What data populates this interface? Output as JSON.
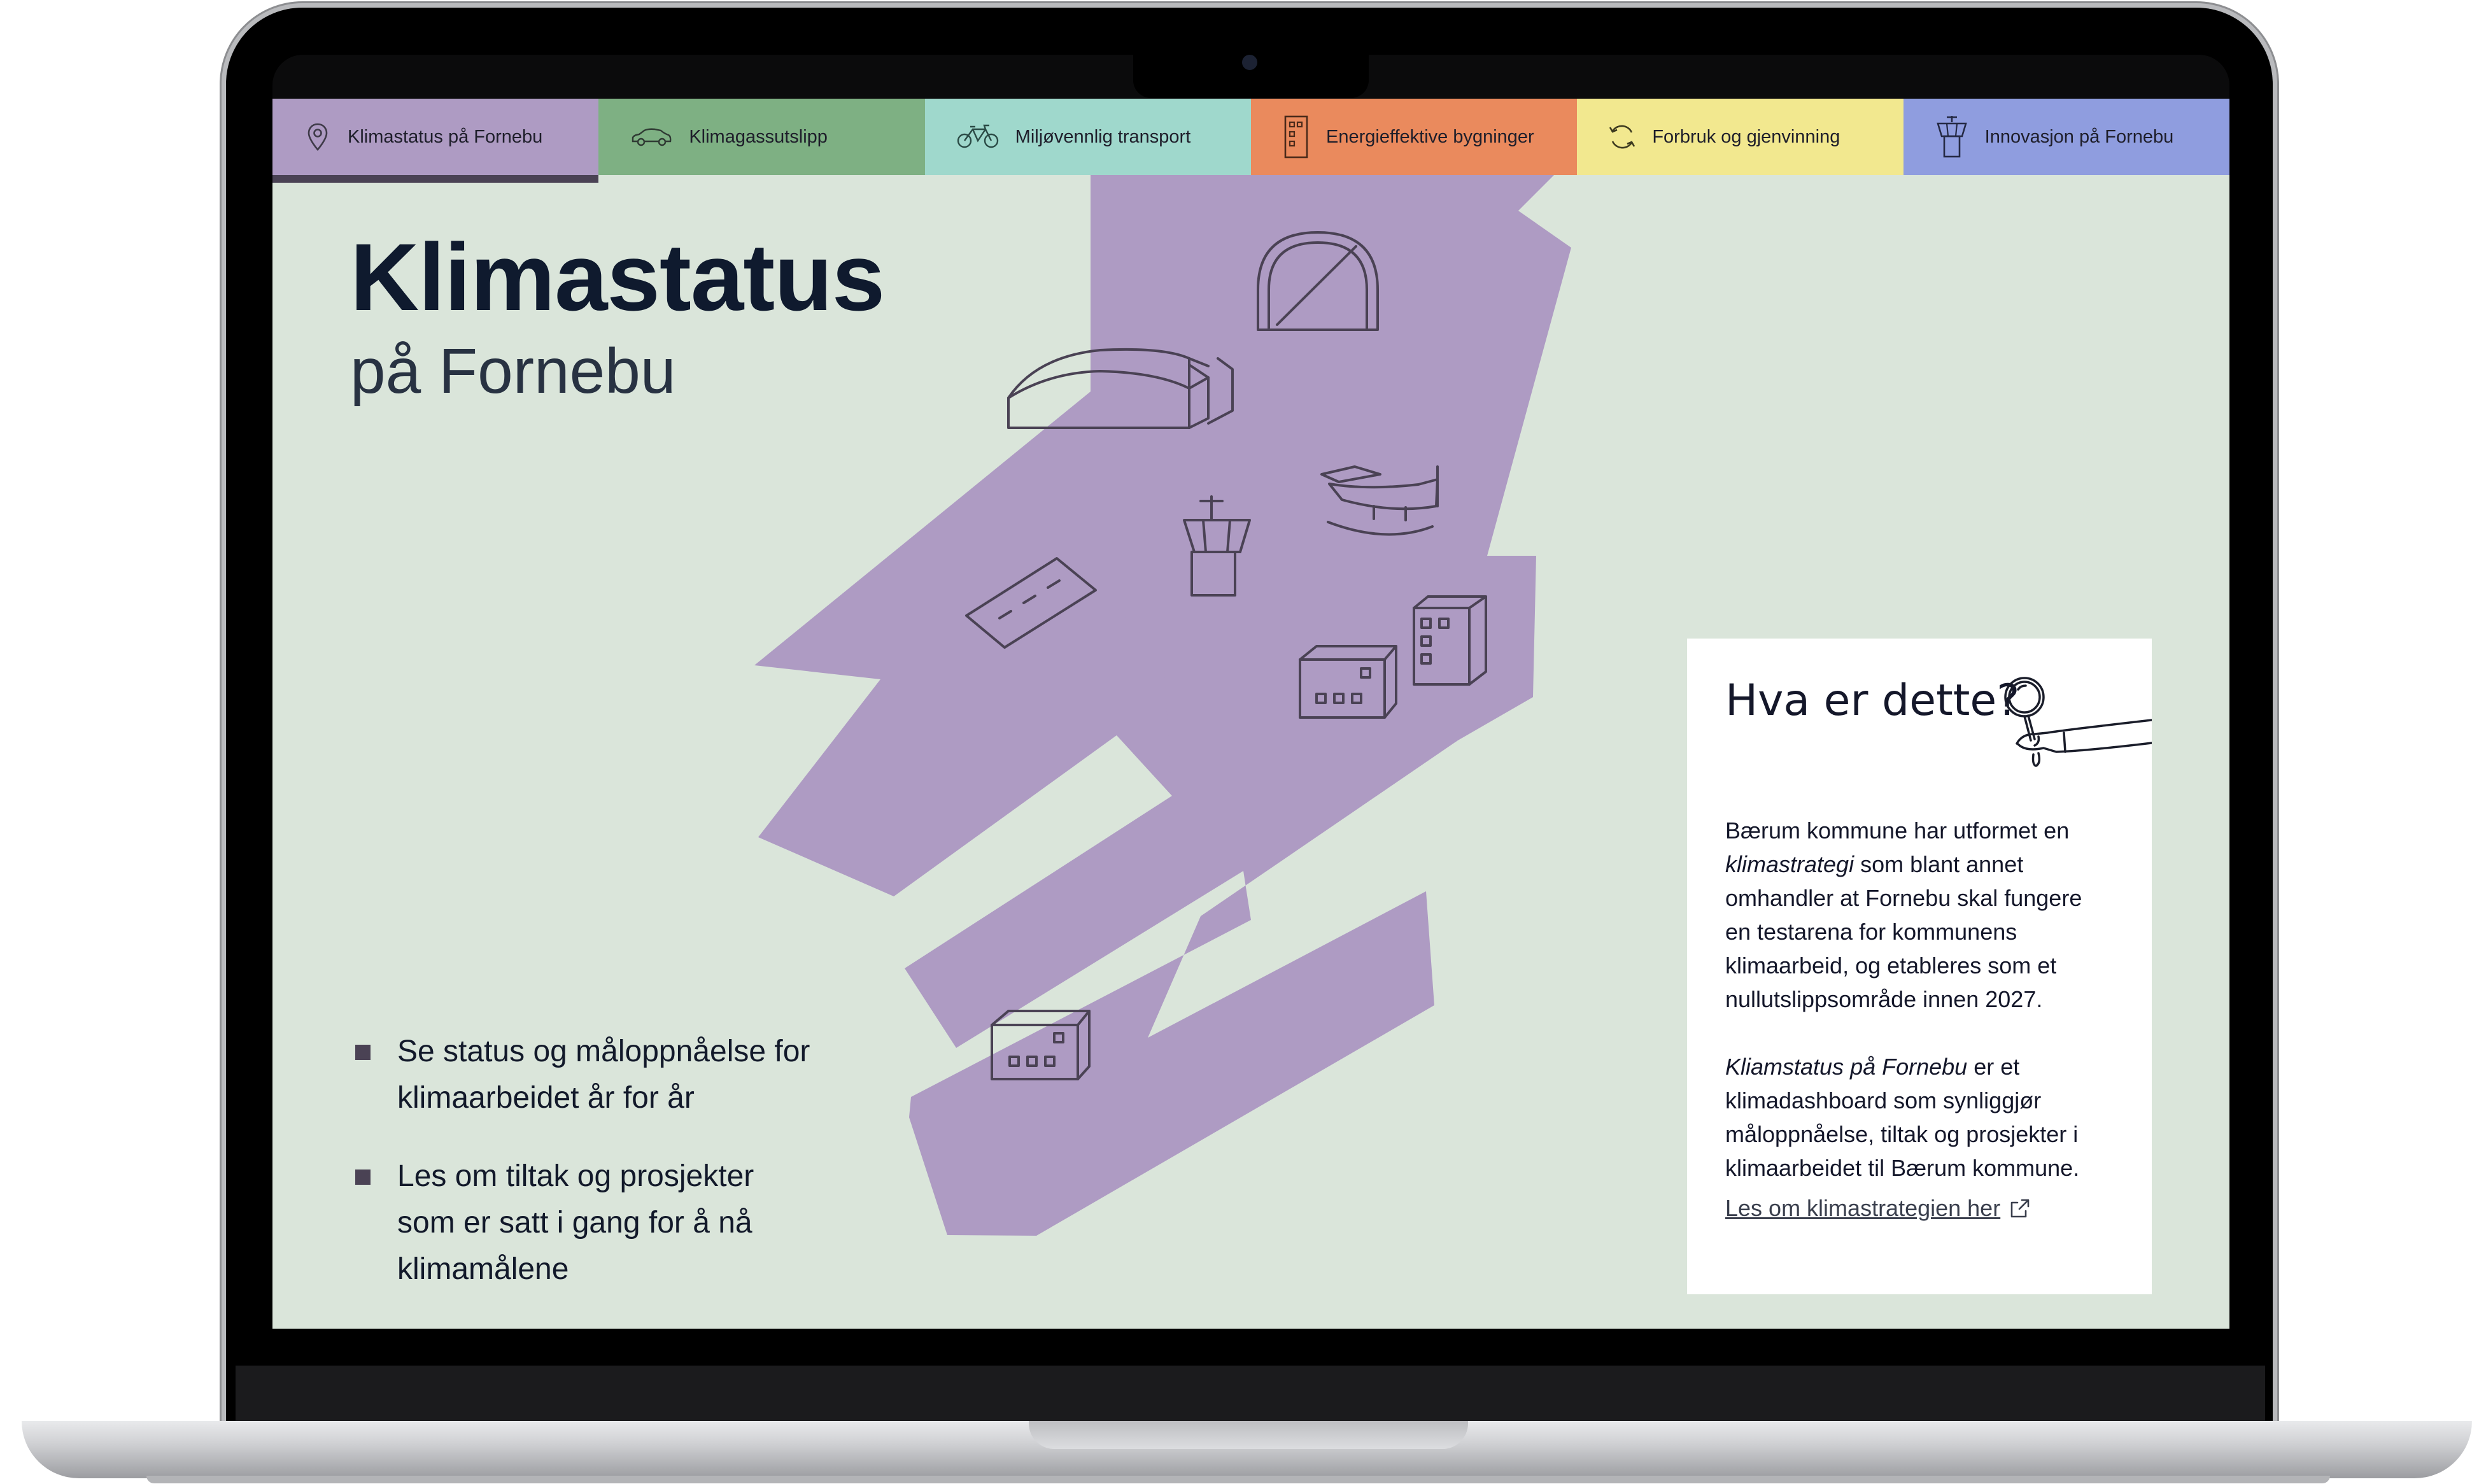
{
  "nav": {
    "tabs": [
      {
        "label": "Klimastatus på Fornebu",
        "icon": "location-pin-icon",
        "color": "#ae9bc3",
        "active": true
      },
      {
        "label": "Klimagassutslipp",
        "icon": "car-icon",
        "color": "#7eb083",
        "active": false
      },
      {
        "label": "Miljøvennlig transport",
        "icon": "bicycle-icon",
        "color": "#9fd8cc",
        "active": false
      },
      {
        "label": "Energieffektive bygninger",
        "icon": "building-icon",
        "color": "#ea8a5d",
        "active": false
      },
      {
        "label": "Forbruk og gjenvinning",
        "icon": "recycle-icon",
        "color": "#f2e88f",
        "active": false
      },
      {
        "label": "Innovasjon på Fornebu",
        "icon": "control-tower-icon",
        "color": "#8f9ddf",
        "active": false
      }
    ]
  },
  "hero": {
    "title": "Klimastatus",
    "subtitle": "på Fornebu"
  },
  "bullets": [
    "Se status og måloppnåelse for klimaarbeidet år for år",
    "Les om tiltak og prosjekter som er satt i gang for å nå klimamålene"
  ],
  "info_card": {
    "title": "Hva er dette?",
    "p1": {
      "pre": "Bærum kommune har utformet en ",
      "em": "klimastrategi",
      "post": " som blant annet omhandler at Fornebu skal fungere en testarena for kommunens klimaarbeid, og etableres som et nullutslippsområde innen 2027."
    },
    "p2": {
      "em": "Kliamstatus på Fornebu",
      "post": " er et klimadashboard som synliggjør måloppnåelse, tiltak og prosjekter i klimaarbeidet til Bærum kommune."
    },
    "link": "Les om klimastrategien her"
  },
  "colors": {
    "background": "#dae5da",
    "shape": "#ae9bc3",
    "title": "#0f1a2e",
    "bullet_marker": "#4a4254"
  }
}
